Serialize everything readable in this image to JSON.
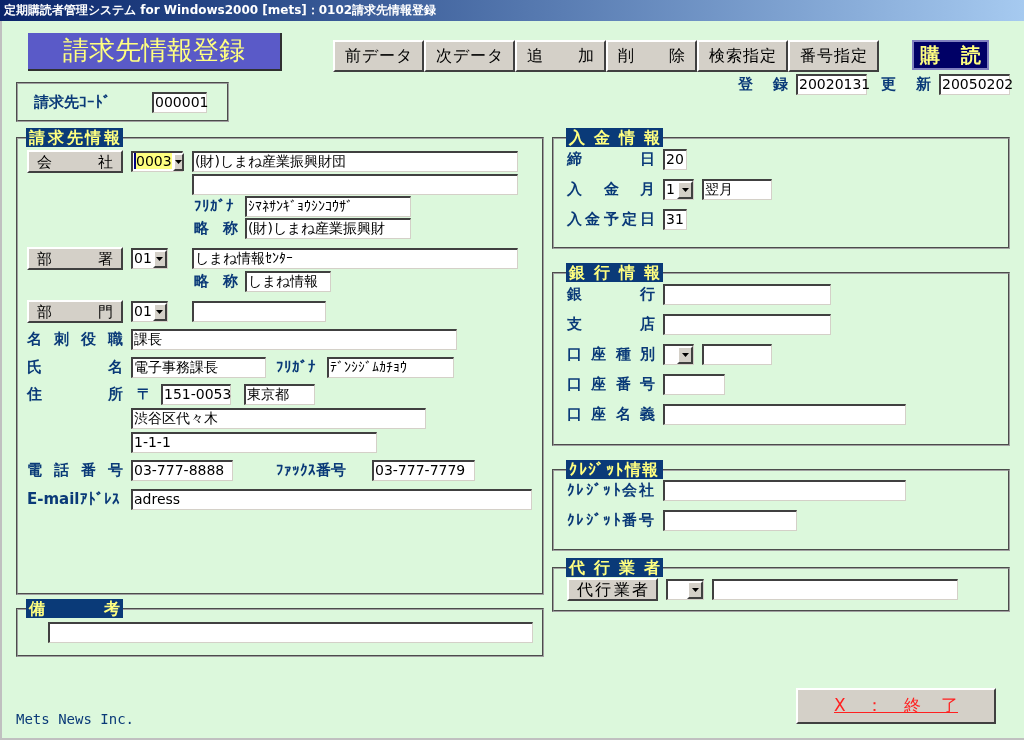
{
  "window": {
    "title": "定期購読者管理システム for Windows2000 [mets]：0102請求先情報登録"
  },
  "header": {
    "form_title": "請求先情報登録",
    "toolbar": [
      "前データ",
      "次データ",
      "追加",
      "削除",
      "検索指定",
      "番号指定"
    ],
    "mode": "購読",
    "code": {
      "label": "請求先ｺｰﾄﾞ",
      "value": "000001"
    },
    "dates": [
      {
        "label": "登録",
        "value": "20020131"
      },
      {
        "label": "更新",
        "value": "20050202"
      }
    ]
  },
  "billing": {
    "title": "請求先情報",
    "company": {
      "button": "会社",
      "code": {
        "value": "0003",
        "focused": true
      },
      "name": "(財)しまね産業振興財団",
      "kana_label": "ﾌﾘｶﾞﾅ",
      "kana": "ｼﾏﾈｻﾝｷﾞｮｳｼﾝｺｳｻﾞ",
      "short_label": "略称",
      "short": "(財)しまね産業振興財"
    },
    "department": {
      "button": "部署",
      "code": {
        "value": "01",
        "focused": false
      },
      "name": "しまね情報ｾﾝﾀｰ",
      "short_label": "略称",
      "short": "しまね情報"
    },
    "division": {
      "button": "部門",
      "code": {
        "value": "01",
        "focused": false
      }
    },
    "position": {
      "label": "名刺役職",
      "value": "課長"
    },
    "person": {
      "label": "氏名",
      "value": "電子事務課長",
      "kana_label": "ﾌﾘｶﾞﾅ",
      "kana": "ﾃﾞﾝｼｼﾞﾑｶﾁｮｳ"
    },
    "address": {
      "label": "住所",
      "postal_mark": "〒",
      "postal_code": "151-0053",
      "prefecture": "東京都",
      "line_1": "渋谷区代々木",
      "line_2": "1-1-1"
    },
    "phone": {
      "label": "電話番号",
      "value": "03-777-8888",
      "fax_label": "ﾌｧｯｸｽ番号",
      "fax": "03-777-7779"
    },
    "email": {
      "label": "E-mailｱﾄﾞﾚｽ",
      "value": "adress"
    }
  },
  "remarks": {
    "title": "備考"
  },
  "payment": {
    "title": "入金情報",
    "closing_day": {
      "label": "締日",
      "value": "20"
    },
    "month": {
      "label": "入金月",
      "code": {
        "value": "1",
        "focused": false
      },
      "text": "翌月"
    },
    "due_day": {
      "label": "入金予定日",
      "value": "31"
    }
  },
  "bank": {
    "title": "銀行情報",
    "bank_label": "銀行",
    "branch_label": "支店",
    "type_label": "口座種別",
    "number_label": "口座番号",
    "holder_label": "口座名義"
  },
  "credit": {
    "title": "ｸﾚｼﾞｯﾄ情報",
    "company_label": "ｸﾚｼﾞｯﾄ会社",
    "number_label": "ｸﾚｼﾞｯﾄ番号"
  },
  "agent": {
    "title": "代行業者",
    "button": "代行業者"
  },
  "footer": {
    "company": "Mets News Inc.",
    "exit_button": "X：終了"
  }
}
